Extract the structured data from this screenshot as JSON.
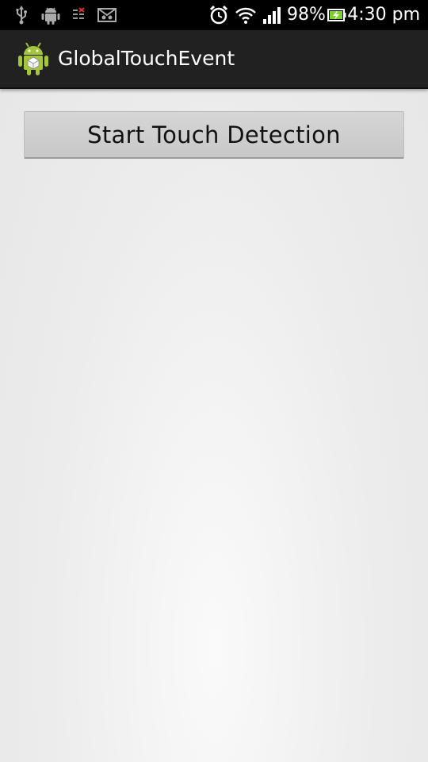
{
  "status_bar": {
    "icons_left": [
      "usb-icon",
      "android-debug-icon",
      "sim-card-icon",
      "voicemail-icon"
    ],
    "icons_right": [
      "alarm-clock-icon",
      "wifi-icon",
      "signal-strength-icon",
      "battery-charging-icon"
    ],
    "battery_percent": "98%",
    "time": "4:30 pm",
    "colors": {
      "background": "#000000",
      "text": "#ffffff"
    }
  },
  "action_bar": {
    "app_icon": "android-app-icon",
    "title": "GlobalTouchEvent",
    "colors": {
      "background": "#212121",
      "text": "#ffffff"
    }
  },
  "main": {
    "start_button_label": "Start Touch Detection",
    "colors": {
      "button": "#cccccc",
      "background": "#ececec"
    }
  }
}
